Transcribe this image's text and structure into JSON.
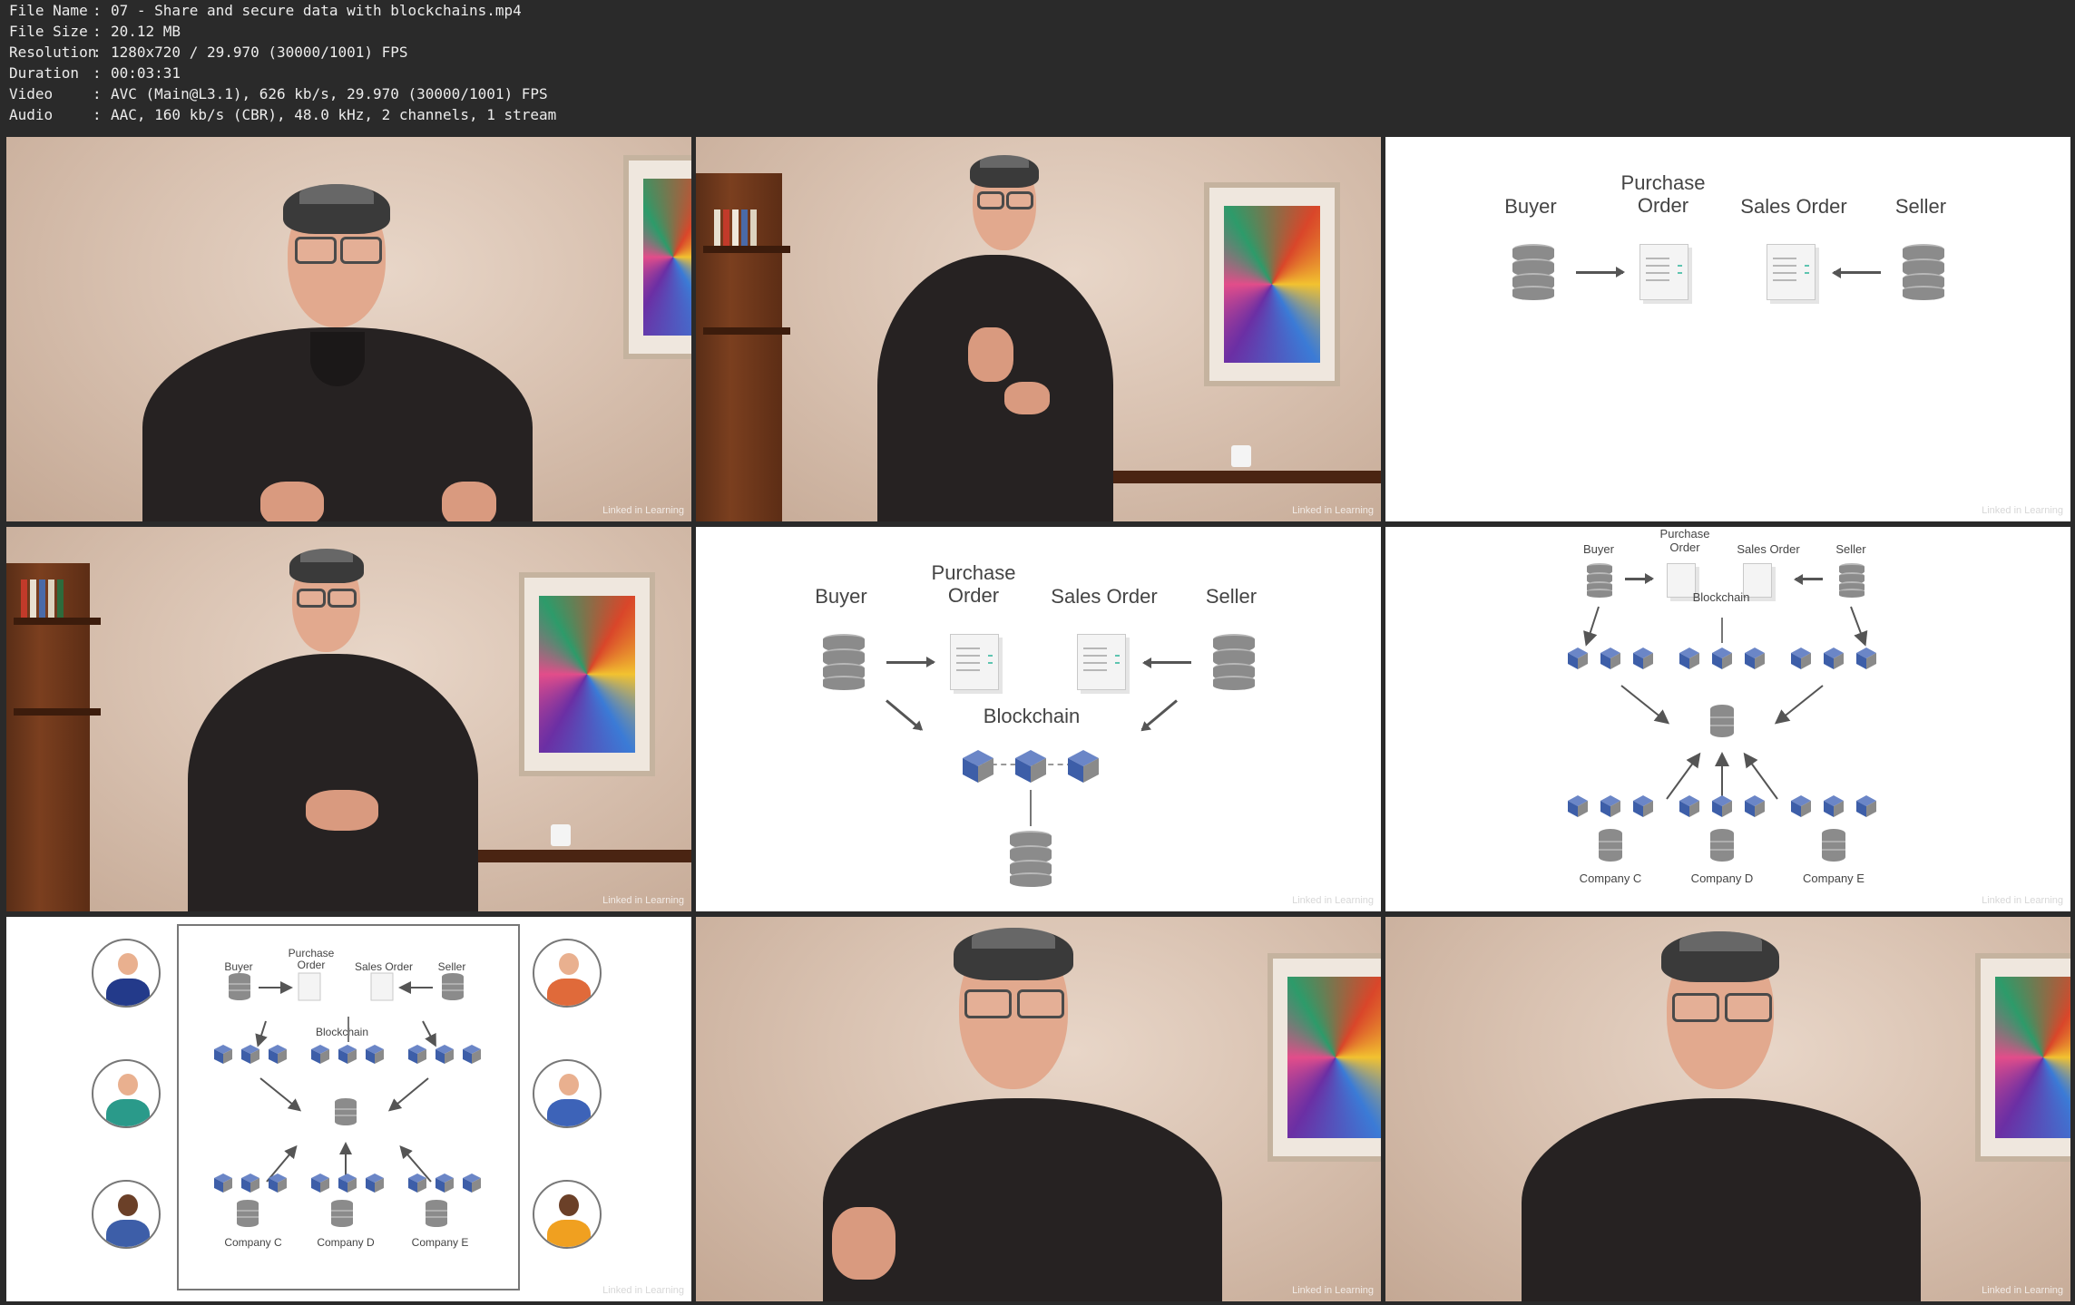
{
  "file_info": {
    "rows": [
      {
        "key": "File Name",
        "value": "07 - Share and secure data with blockchains.mp4"
      },
      {
        "key": "File Size",
        "value": "20.12 MB"
      },
      {
        "key": "Resolution",
        "value": "1280x720 / 29.970 (30000/1001) FPS"
      },
      {
        "key": "Duration",
        "value": "00:03:31"
      },
      {
        "key": "Video",
        "value": "AVC (Main@L3.1), 626 kb/s, 29.970 (30000/1001) FPS"
      },
      {
        "key": "Audio",
        "value": "AAC, 160 kb/s (CBR), 48.0 kHz, 2 channels, 1 stream"
      }
    ],
    "separator": ":"
  },
  "watermark": "Linked in Learning",
  "diagram": {
    "buyer": "Buyer",
    "purchase_order": "Purchase\nOrder",
    "sales_order": "Sales Order",
    "seller": "Seller",
    "blockchain": "Blockchain",
    "company_c": "Company C",
    "company_d": "Company D",
    "company_e": "Company E"
  },
  "colors": {
    "background": "#2a2a2a",
    "header_text": "#ececec",
    "cube_blue": "#3d5ea8",
    "cube_gray": "#9a9a9a",
    "database": "#8b8b8b",
    "doc_accent": "#5ec4b0"
  }
}
